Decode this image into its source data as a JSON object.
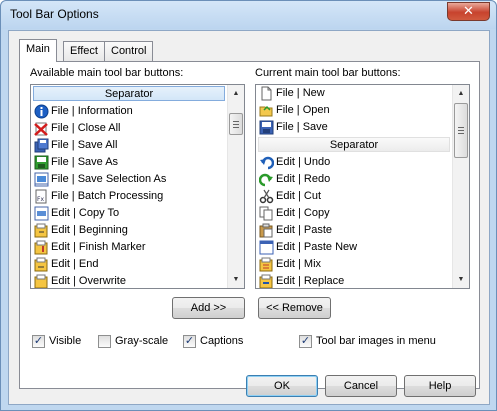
{
  "window": {
    "title": "Tool Bar Options",
    "close_glyph": "✕"
  },
  "tabs": [
    {
      "label": "Main",
      "active": true
    },
    {
      "label": "Effect",
      "active": false
    },
    {
      "label": "Control",
      "active": false
    }
  ],
  "available": {
    "label": "Available main tool bar buttons:",
    "items": [
      {
        "label": "Separator",
        "icon": "separator",
        "separator": true,
        "selected": true
      },
      {
        "label": "File | Information",
        "icon": "info-icon"
      },
      {
        "label": "File | Close All",
        "icon": "close-all-icon"
      },
      {
        "label": "File | Save All",
        "icon": "save-all-icon"
      },
      {
        "label": "File | Save As",
        "icon": "save-as-icon"
      },
      {
        "label": "File | Save Selection As",
        "icon": "save-selection-icon"
      },
      {
        "label": "File | Batch Processing",
        "icon": "batch-icon"
      },
      {
        "label": "Edit | Copy To",
        "icon": "copy-to-icon"
      },
      {
        "label": "Edit | Beginning",
        "icon": "beginning-icon"
      },
      {
        "label": "Edit | Finish Marker",
        "icon": "finish-marker-icon"
      },
      {
        "label": "Edit | End",
        "icon": "end-icon"
      },
      {
        "label": "Edit | Overwrite",
        "icon": "overwrite-icon"
      }
    ]
  },
  "current": {
    "label": "Current main tool bar buttons:",
    "items": [
      {
        "label": "File | New",
        "icon": "new-file-icon"
      },
      {
        "label": "File | Open",
        "icon": "open-folder-icon"
      },
      {
        "label": "File | Save",
        "icon": "save-icon"
      },
      {
        "label": "Separator",
        "icon": "separator",
        "separator": true
      },
      {
        "label": "Edit | Undo",
        "icon": "undo-icon"
      },
      {
        "label": "Edit | Redo",
        "icon": "redo-icon"
      },
      {
        "label": "Edit | Cut",
        "icon": "cut-icon"
      },
      {
        "label": "Edit | Copy",
        "icon": "copy-icon"
      },
      {
        "label": "Edit | Paste",
        "icon": "paste-icon"
      },
      {
        "label": "Edit | Paste New",
        "icon": "paste-new-icon"
      },
      {
        "label": "Edit | Mix",
        "icon": "mix-icon"
      },
      {
        "label": "Edit | Replace",
        "icon": "replace-icon"
      }
    ]
  },
  "buttons": {
    "add": "Add >>",
    "remove": "<< Remove",
    "ok": "OK",
    "cancel": "Cancel",
    "help": "Help"
  },
  "checkboxes": [
    {
      "label": "Visible",
      "checked": true
    },
    {
      "label": "Gray-scale",
      "checked": false
    },
    {
      "label": "Captions",
      "checked": true
    },
    {
      "label": "Tool bar images in menu",
      "checked": true
    }
  ],
  "colors": {
    "accent": "#3c7fb1",
    "selection_border": "#84acdd",
    "window_frame": "#bfd7ef"
  }
}
